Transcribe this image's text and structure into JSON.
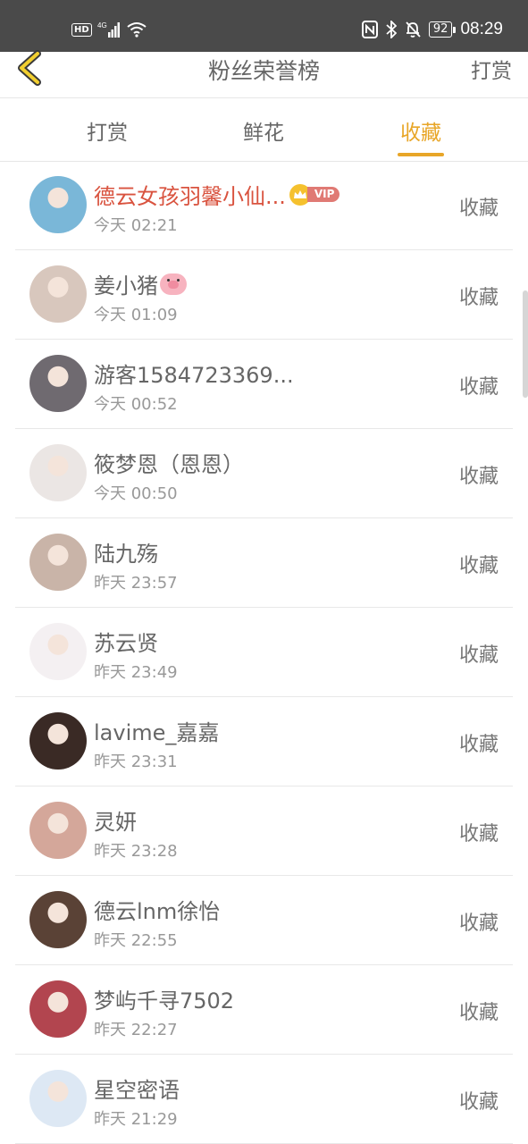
{
  "status_bar": {
    "hd": "HD",
    "network": "4G",
    "battery": "92",
    "time": "08:29"
  },
  "nav": {
    "title": "粉丝荣誉榜",
    "action": "打赏"
  },
  "tabs": [
    {
      "label": "打赏",
      "active": false
    },
    {
      "label": "鲜花",
      "active": false
    },
    {
      "label": "收藏",
      "active": true
    }
  ],
  "accent_color": "#e8a628",
  "vip_name_color": "#d9533f",
  "list": [
    {
      "name": "德云女孩羽馨小仙...",
      "time": "今天 02:21",
      "action": "收藏",
      "vip": true,
      "vip_label": "VIP",
      "avatar_color": "#7ab7d8"
    },
    {
      "name": "姜小猪",
      "time": "今天 01:09",
      "action": "收藏",
      "emoji": "pig-face-icon",
      "avatar_color": "#d8c7bd"
    },
    {
      "name": "游客1584723369...",
      "time": "今天 00:52",
      "action": "收藏",
      "avatar_color": "#6f6a70"
    },
    {
      "name": "筱梦恩（恩恩）",
      "time": "今天 00:50",
      "action": "收藏",
      "avatar_color": "#ebe6e4"
    },
    {
      "name": "陆九殇",
      "time": "昨天 23:57",
      "action": "收藏",
      "avatar_color": "#c9b4a8"
    },
    {
      "name": "苏云贤",
      "time": "昨天 23:49",
      "action": "收藏",
      "avatar_color": "#f4f0f2"
    },
    {
      "name": "lavime_嘉嘉",
      "time": "昨天 23:31",
      "action": "收藏",
      "avatar_color": "#3a2a25"
    },
    {
      "name": "灵妍",
      "time": "昨天 23:28",
      "action": "收藏",
      "avatar_color": "#d4a79a"
    },
    {
      "name": "德云lnm徐怡",
      "time": "昨天 22:55",
      "action": "收藏",
      "avatar_color": "#5a4236"
    },
    {
      "name": "梦屿千寻7502",
      "time": "昨天 22:27",
      "action": "收藏",
      "avatar_color": "#b2454f"
    },
    {
      "name": "星空密语",
      "time": "昨天 21:29",
      "action": "收藏",
      "avatar_color": "#dde8f4"
    }
  ]
}
